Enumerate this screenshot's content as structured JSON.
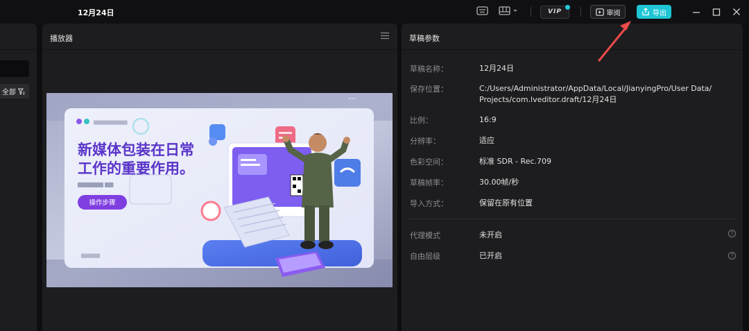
{
  "window": {
    "title": "12月24日"
  },
  "toolbar": {
    "vip_label": "VIP",
    "review_label": "审阅",
    "export_label": "导出"
  },
  "left_panel": {
    "filter_label": "全部"
  },
  "player": {
    "title": "播放器",
    "preview": {
      "headline_1": "新媒体包装在日常",
      "headline_2": "工作的重要作用。",
      "button_label": "操作步骤",
      "subtitle_blur": "▆▆▆▆▆▆ ▆▆",
      "header_blur": "▆▆▆▆▆▆▆▆▆",
      "footer_blur": "▆▆▆▆▆"
    }
  },
  "draft_params": {
    "title": "草稿参数",
    "rows": [
      {
        "label": "草稿名称：",
        "value": "12月24日"
      },
      {
        "label": "保存位置：",
        "value_line1": "C:/Users/Administrator/AppData/Local/JianyingPro/User Data/",
        "value_line2": "Projects/com.lveditor.draft/12月24日"
      },
      {
        "label": "比例：",
        "value": "16:9"
      },
      {
        "label": "分辨率：",
        "value": "适应"
      },
      {
        "label": "色彩空间：",
        "value": "标准 SDR - Rec.709"
      },
      {
        "label": "草稿帧率：",
        "value": "30.00帧/秒"
      },
      {
        "label": "导入方式：",
        "value": "保留在原有位置"
      },
      {
        "label": "代理模式",
        "value": "未开启"
      },
      {
        "label": "自由层级",
        "value": "已开启"
      }
    ]
  },
  "colors": {
    "accent": "#1ec6d5",
    "annotation_arrow": "#ee4b4b",
    "panel_bg": "#1d1d1f"
  }
}
